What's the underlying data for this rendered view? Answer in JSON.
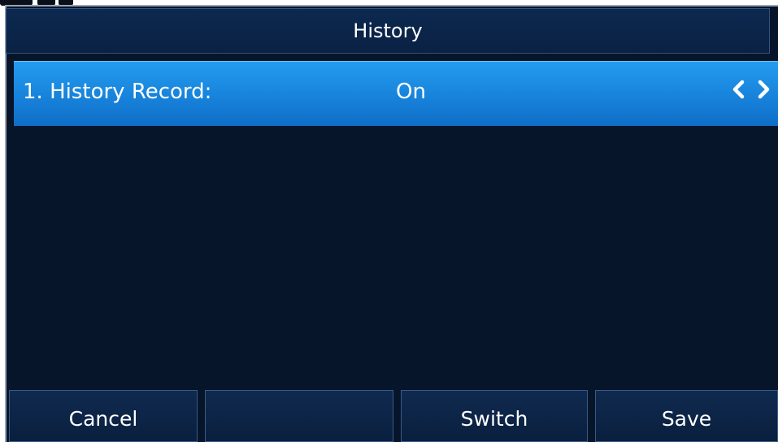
{
  "header": {
    "title": "History"
  },
  "list": {
    "items": [
      {
        "label": "1. History Record:",
        "value": "On",
        "prev_icon": "chevron-left-icon",
        "next_icon": "chevron-right-icon"
      }
    ]
  },
  "softkeys": {
    "items": [
      {
        "label": "Cancel"
      },
      {
        "label": ""
      },
      {
        "label": "Switch"
      },
      {
        "label": "Save"
      }
    ]
  },
  "colors": {
    "background": "#06152a",
    "selected_row": "#1a86df",
    "text": "#ffffff"
  }
}
